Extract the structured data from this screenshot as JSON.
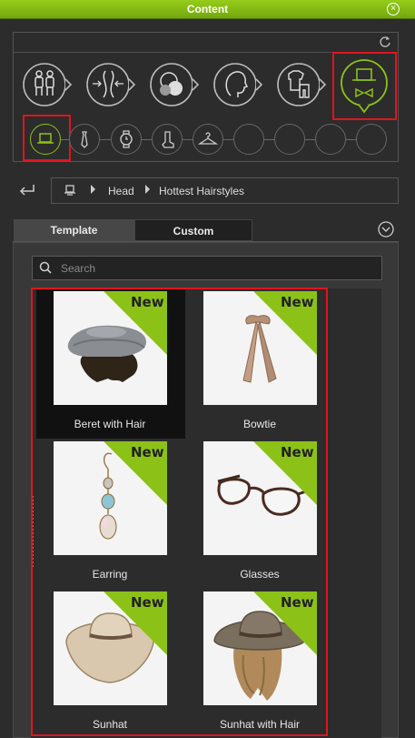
{
  "window": {
    "title": "Content",
    "close_icon": "close-circle-icon"
  },
  "category_bar": {
    "refresh_icon": "refresh-icon",
    "categories": [
      {
        "name": "characters",
        "icon": "characters-icon",
        "selected": false
      },
      {
        "name": "morph",
        "icon": "body-morph-icon",
        "selected": false
      },
      {
        "name": "skin",
        "icon": "skin-materials-icon",
        "selected": false
      },
      {
        "name": "head",
        "icon": "head-profile-icon",
        "selected": false
      },
      {
        "name": "clothes",
        "icon": "clothes-icon",
        "selected": false
      },
      {
        "name": "accessories",
        "icon": "hat-bowtie-icon",
        "selected": true
      }
    ],
    "subcategories": [
      {
        "name": "hat",
        "icon": "hat-icon",
        "selected": true
      },
      {
        "name": "tie",
        "icon": "tie-icon",
        "selected": false
      },
      {
        "name": "watch",
        "icon": "watch-icon",
        "selected": false
      },
      {
        "name": "sock",
        "icon": "sock-icon",
        "selected": false
      },
      {
        "name": "hanger",
        "icon": "hanger-icon",
        "selected": false
      },
      {
        "name": "empty-1",
        "icon": "",
        "selected": false
      },
      {
        "name": "empty-2",
        "icon": "",
        "selected": false
      },
      {
        "name": "empty-3",
        "icon": "",
        "selected": false
      },
      {
        "name": "empty-4",
        "icon": "",
        "selected": false
      }
    ]
  },
  "breadcrumb": {
    "back_icon": "back-arrow-icon",
    "root_icon": "hat-icon",
    "items": [
      "Head",
      "Hottest Hairstyles"
    ]
  },
  "tabs": {
    "template": "Template",
    "custom": "Custom",
    "active": "Template"
  },
  "search": {
    "placeholder": "Search",
    "value": ""
  },
  "items": [
    {
      "label": "Beret with Hair",
      "badge": "New",
      "selected": true
    },
    {
      "label": "Bowtie",
      "badge": "New",
      "selected": false
    },
    {
      "label": "Earring",
      "badge": "New",
      "selected": false
    },
    {
      "label": "Glasses",
      "badge": "New",
      "selected": false
    },
    {
      "label": "Sunhat",
      "badge": "New",
      "selected": false
    },
    {
      "label": "Sunhat with Hair",
      "badge": "New",
      "selected": false
    }
  ],
  "colors": {
    "accent": "#8cc218",
    "highlight": "#e0141e"
  }
}
